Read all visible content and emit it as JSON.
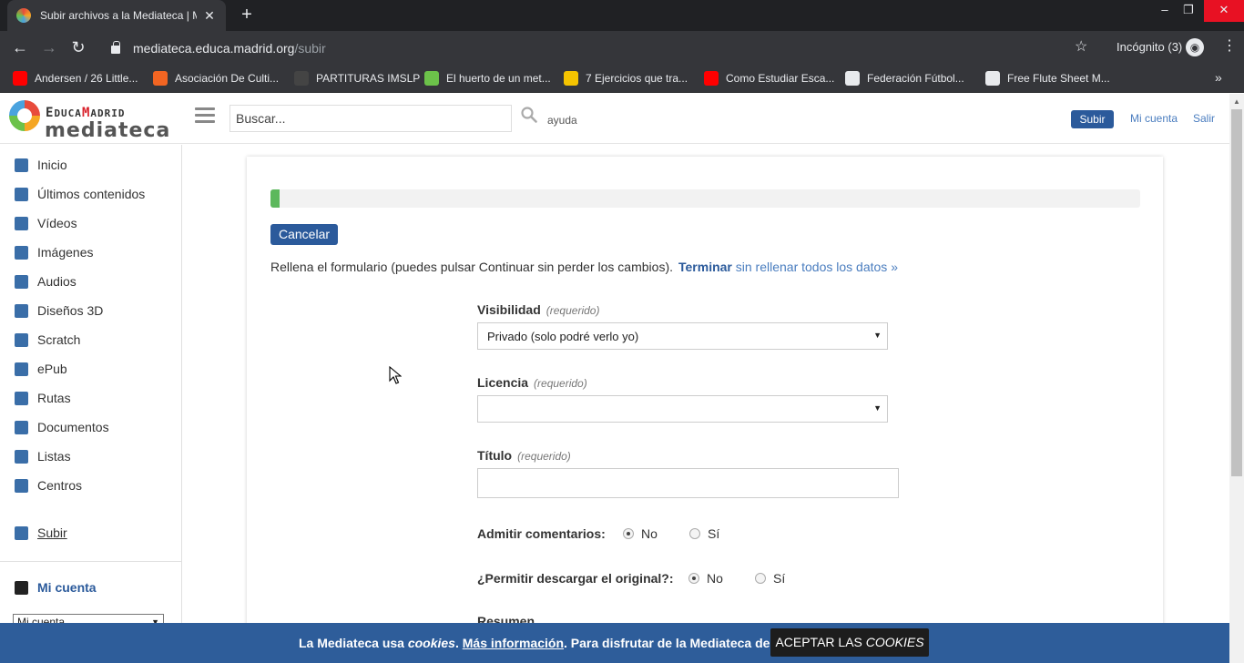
{
  "browser": {
    "tab_title": "Subir archivos a la Mediateca | M",
    "tab_close": "✕",
    "new_tab": "+",
    "url_host": "mediateca.educa.madrid.org",
    "url_path": "/subir",
    "incognito_label": "Incógnito (3)",
    "bookmarks": [
      {
        "label": "Andersen / 26 Little...",
        "icon_color": "#ff0000",
        "icon": "youtube-icon"
      },
      {
        "label": "Asociación De Culti...",
        "icon_color": "#f26522",
        "icon": "orange-circle-icon"
      },
      {
        "label": "PARTITURAS IMSLP",
        "icon_color": "#444444",
        "icon": "imslp-icon"
      },
      {
        "label": "El huerto de un met...",
        "icon_color": "#6cc24a",
        "icon": "leaf-icon"
      },
      {
        "label": "7 Ejercicios que tra...",
        "icon_color": "#f5c400",
        "icon": "ge-icon"
      },
      {
        "label": "Como Estudiar Esca...",
        "icon_color": "#ff0000",
        "icon": "youtube-icon"
      },
      {
        "label": "Federación Fútbol...",
        "icon_color": "#e8eaed",
        "icon": "globe-icon"
      },
      {
        "label": "Free Flute Sheet M...",
        "icon_color": "#e8eaed",
        "icon": "flute-icon"
      }
    ],
    "bookmarks_more": "»"
  },
  "site": {
    "logo_top_parts": [
      "E",
      "DUCA",
      "M",
      "ADRID"
    ],
    "logo_bottom": "mediateca",
    "search_placeholder": "Buscar...",
    "help_label": "ayuda",
    "upload_button": "Subir",
    "account_link": "Mi cuenta",
    "logout_link": "Salir"
  },
  "sidebar": {
    "items": [
      {
        "label": "Inicio",
        "icon": "home-icon"
      },
      {
        "label": "Últimos contenidos",
        "icon": "clock-icon"
      },
      {
        "label": "Vídeos",
        "icon": "play-icon"
      },
      {
        "label": "Imágenes",
        "icon": "camera-icon"
      },
      {
        "label": "Audios",
        "icon": "speaker-icon"
      },
      {
        "label": "Diseños 3D",
        "icon": "cube-icon"
      },
      {
        "label": "Scratch",
        "icon": "scratch-icon"
      },
      {
        "label": "ePub",
        "icon": "epub-icon"
      },
      {
        "label": "Rutas",
        "icon": "flag-icon"
      },
      {
        "label": "Documentos",
        "icon": "document-icon"
      },
      {
        "label": "Listas",
        "icon": "list-icon"
      },
      {
        "label": "Centros",
        "icon": "school-icon"
      }
    ],
    "upload_item": {
      "label": "Subir",
      "icon": "upload-icon"
    },
    "account_heading": "Mi cuenta",
    "account_select_value": "Mi cuenta"
  },
  "form": {
    "progress_fraction": 0.01,
    "cancel_button": "Cancelar",
    "instructions": "Rellena el formulario (puedes pulsar Continuar sin perder los cambios).",
    "finish_strong": "Terminar",
    "finish_rest": " sin rellenar todos los datos »",
    "required_tag": "(requerido)",
    "visibility_label": "Visibilidad",
    "visibility_value": "Privado (solo podré verlo yo)",
    "license_label": "Licencia",
    "license_value": "",
    "title_label": "Título",
    "title_value": "",
    "comments_label": "Admitir comentarios:",
    "download_label": "¿Permitir descargar el original?:",
    "option_no": "No",
    "option_yes": "Sí",
    "comments_selected": "No",
    "download_selected": "No",
    "summary_label": "Resumen"
  },
  "cookies": {
    "text_a": "La Mediateca usa ",
    "text_cookies": "cookies",
    "text_b": ". ",
    "more_info": "Más información",
    "text_c": ". Para disfrutar de la Mediateca debes...",
    "accept_a": "ACEPTAR LAS ",
    "accept_b": "COOKIES"
  }
}
